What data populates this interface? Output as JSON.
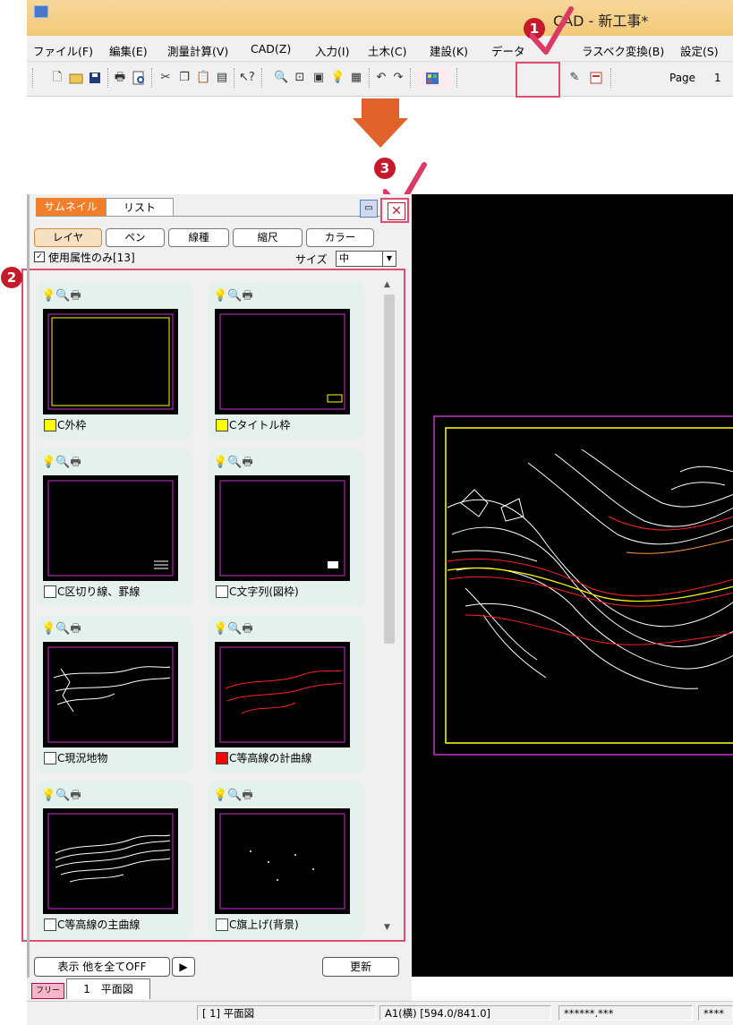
{
  "window": {
    "title": "CAD - 新工事*"
  },
  "menubar": {
    "items": [
      "ファイル(F)",
      "編集(E)",
      "測量計算(V)",
      "CAD(Z)",
      "入力(I)",
      "土木(C)",
      "建設(K)",
      "データ",
      "ラスベク変換(B)",
      "設定(S)"
    ]
  },
  "toolbar": {
    "page_label": "Page",
    "page_number": "1"
  },
  "markers": {
    "m1": "1",
    "m2": "2",
    "m3": "3"
  },
  "panel": {
    "tabs": [
      "サムネイル",
      "リスト"
    ],
    "filters": [
      "レイヤ",
      "ペン",
      "線種",
      "縮尺",
      "カラー"
    ],
    "used_only_label": "使用属性のみ[13]",
    "size_label": "サイズ",
    "size_value": "中",
    "layers": [
      {
        "name": "C外枠",
        "color": "#ffff00"
      },
      {
        "name": "Cタイトル枠",
        "color": "#ffff00"
      },
      {
        "name": "C区切り線、罫線",
        "color": "#ffffff"
      },
      {
        "name": "C文字列(図枠)",
        "color": "#ffffff"
      },
      {
        "name": "C現況地物",
        "color": "#ffffff"
      },
      {
        "name": "C等高線の計曲線",
        "color": "#ff0000"
      },
      {
        "name": "C等高線の主曲線",
        "color": "#ffffff"
      },
      {
        "name": "C旗上げ(背景)",
        "color": "#ffffff"
      }
    ],
    "display_others_off": "表示 他を全てOFF",
    "refresh": "更新"
  },
  "layout_tabs": {
    "free": "フリー",
    "sheet_number": "1",
    "sheet_name": "平面図"
  },
  "statusbar": {
    "sheet": "[ 1] 平面図",
    "paper": "A1(横) [594.0/841.0]",
    "coord1": "******.***",
    "coord2": "****"
  },
  "colors": {
    "accent_orange": "#f27d2a",
    "highlight": "#e04d72",
    "marker": "#c41a2c",
    "frame_magenta": "#cc33cc",
    "frame_yellow": "#ffff00"
  }
}
